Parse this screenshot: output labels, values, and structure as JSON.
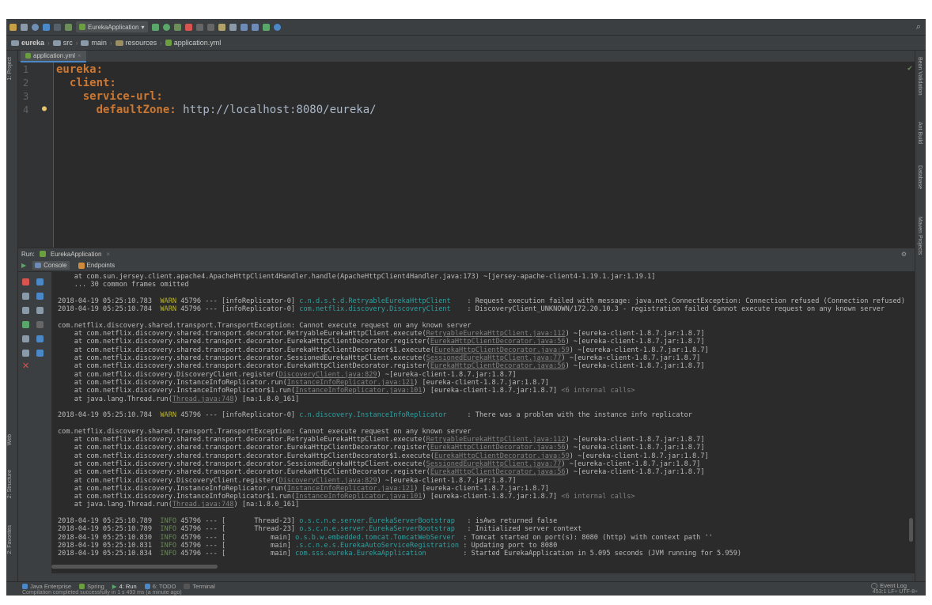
{
  "toolbar": {
    "run_config": "EurekaApplication"
  },
  "breadcrumb": [
    "eureka",
    "src",
    "main",
    "resources",
    "application.yml"
  ],
  "editor": {
    "tab": "application.yml",
    "lines": [
      {
        "n": "1",
        "key": "eureka:",
        "value": ""
      },
      {
        "n": "2",
        "key": "  client:",
        "value": ""
      },
      {
        "n": "3",
        "key": "    service-url:",
        "value": ""
      },
      {
        "n": "4",
        "key": "      defaultZone:",
        "value": " http://localhost:8080/eureka/"
      }
    ]
  },
  "left_strip": {
    "project": "1: Project",
    "web": "Web",
    "structure": "2: Structure",
    "favorites": "2: Favorites"
  },
  "right_strip": {
    "bean": "Bean Validation",
    "ant": "Ant Build",
    "database": "Database",
    "maven": "Maven Projects"
  },
  "run": {
    "label": "Run:",
    "config": "EurekaApplication",
    "console_tab": "Console",
    "endpoints_tab": "Endpoints"
  },
  "console": [
    {
      "t": "plain",
      "parts": [
        {
          "c": "",
          "s": "    at com.sun.jersey.client.apache4.ApacheHttpClient4Handler.handle(ApacheHttpClient4Handler.java:173) ~[jersey-apache-client4-1.19.1.jar:1.19.1]"
        }
      ]
    },
    {
      "t": "plain",
      "parts": [
        {
          "c": "",
          "s": "    ... 30 common frames omitted"
        }
      ]
    },
    {
      "t": "blank"
    },
    {
      "t": "log",
      "parts": [
        {
          "c": "",
          "s": "2018-04-19 05:25:10.783  "
        },
        {
          "c": "warn",
          "s": "WARN"
        },
        {
          "c": "",
          "s": " 45796 --- [infoReplicator-0] "
        },
        {
          "c": "cls",
          "s": "c.n.d.s.t.d.RetryableEurekaHttpClient"
        },
        {
          "c": "",
          "s": "    : Request execution failed with message: java.net.ConnectException: Connection refused (Connection refused)"
        }
      ]
    },
    {
      "t": "log",
      "parts": [
        {
          "c": "",
          "s": "2018-04-19 05:25:10.784  "
        },
        {
          "c": "warn",
          "s": "WARN"
        },
        {
          "c": "",
          "s": " 45796 --- [infoReplicator-0] "
        },
        {
          "c": "cls",
          "s": "com.netflix.discovery.DiscoveryClient"
        },
        {
          "c": "",
          "s": "    : DiscoveryClient_UNKNOWN/172.20.10.3 - registration failed Cannot execute request on any known server"
        }
      ]
    },
    {
      "t": "blank"
    },
    {
      "t": "plain",
      "parts": [
        {
          "c": "",
          "s": "com.netflix.discovery.shared.transport.TransportException: Cannot execute request on any known server"
        }
      ]
    },
    {
      "t": "plain",
      "parts": [
        {
          "c": "",
          "s": "    at com.netflix.discovery.shared.transport.decorator.RetryableEurekaHttpClient.execute("
        },
        {
          "c": "lnk",
          "s": "RetryableEurekaHttpClient.java:112"
        },
        {
          "c": "",
          "s": ") ~[eureka-client-1.8.7.jar:1.8.7]"
        }
      ]
    },
    {
      "t": "plain",
      "parts": [
        {
          "c": "",
          "s": "    at com.netflix.discovery.shared.transport.decorator.EurekaHttpClientDecorator.register("
        },
        {
          "c": "lnk",
          "s": "EurekaHttpClientDecorator.java:56"
        },
        {
          "c": "",
          "s": ") ~[eureka-client-1.8.7.jar:1.8.7]"
        }
      ]
    },
    {
      "t": "plain",
      "parts": [
        {
          "c": "",
          "s": "    at com.netflix.discovery.shared.transport.decorator.EurekaHttpClientDecorator$1.execute("
        },
        {
          "c": "lnk",
          "s": "EurekaHttpClientDecorator.java:59"
        },
        {
          "c": "",
          "s": ") ~[eureka-client-1.8.7.jar:1.8.7]"
        }
      ]
    },
    {
      "t": "plain",
      "parts": [
        {
          "c": "",
          "s": "    at com.netflix.discovery.shared.transport.decorator.SessionedEurekaHttpClient.execute("
        },
        {
          "c": "lnk",
          "s": "SessionedEurekaHttpClient.java:77"
        },
        {
          "c": "",
          "s": ") ~[eureka-client-1.8.7.jar:1.8.7]"
        }
      ]
    },
    {
      "t": "plain",
      "parts": [
        {
          "c": "",
          "s": "    at com.netflix.discovery.shared.transport.decorator.EurekaHttpClientDecorator.register("
        },
        {
          "c": "lnk",
          "s": "EurekaHttpClientDecorator.java:56"
        },
        {
          "c": "",
          "s": ") ~[eureka-client-1.8.7.jar:1.8.7]"
        }
      ]
    },
    {
      "t": "plain",
      "parts": [
        {
          "c": "",
          "s": "    at com.netflix.discovery.DiscoveryClient.register("
        },
        {
          "c": "lnk",
          "s": "DiscoveryClient.java:829"
        },
        {
          "c": "",
          "s": ") ~[eureka-client-1.8.7.jar:1.8.7]"
        }
      ]
    },
    {
      "t": "plain",
      "parts": [
        {
          "c": "",
          "s": "    at com.netflix.discovery.InstanceInfoReplicator.run("
        },
        {
          "c": "lnk",
          "s": "InstanceInfoReplicator.java:121"
        },
        {
          "c": "",
          "s": ") [eureka-client-1.8.7.jar:1.8.7]"
        }
      ]
    },
    {
      "t": "plain",
      "parts": [
        {
          "c": "",
          "s": "    at com.netflix.discovery.InstanceInfoReplicator$1.run("
        },
        {
          "c": "lnk",
          "s": "InstanceInfoReplicator.java:101"
        },
        {
          "c": "",
          "s": ") [eureka-client-1.8.7.jar:1.8.7] "
        },
        {
          "c": "dim",
          "s": "<6 internal calls>"
        }
      ]
    },
    {
      "t": "plain",
      "parts": [
        {
          "c": "",
          "s": "    at java.lang.Thread.run("
        },
        {
          "c": "lnk",
          "s": "Thread.java:748"
        },
        {
          "c": "",
          "s": ") [na:1.8.0_161]"
        }
      ]
    },
    {
      "t": "blank"
    },
    {
      "t": "log",
      "parts": [
        {
          "c": "",
          "s": "2018-04-19 05:25:10.784  "
        },
        {
          "c": "warn",
          "s": "WARN"
        },
        {
          "c": "",
          "s": " 45796 --- [infoReplicator-0] "
        },
        {
          "c": "cls",
          "s": "c.n.discovery.InstanceInfoReplicator"
        },
        {
          "c": "",
          "s": "     : There was a problem with the instance info replicator"
        }
      ]
    },
    {
      "t": "blank"
    },
    {
      "t": "plain",
      "parts": [
        {
          "c": "",
          "s": "com.netflix.discovery.shared.transport.TransportException: Cannot execute request on any known server"
        }
      ]
    },
    {
      "t": "plain",
      "parts": [
        {
          "c": "",
          "s": "    at com.netflix.discovery.shared.transport.decorator.RetryableEurekaHttpClient.execute("
        },
        {
          "c": "lnk",
          "s": "RetryableEurekaHttpClient.java:112"
        },
        {
          "c": "",
          "s": ") ~[eureka-client-1.8.7.jar:1.8.7]"
        }
      ]
    },
    {
      "t": "plain",
      "parts": [
        {
          "c": "",
          "s": "    at com.netflix.discovery.shared.transport.decorator.EurekaHttpClientDecorator.register("
        },
        {
          "c": "lnk",
          "s": "EurekaHttpClientDecorator.java:56"
        },
        {
          "c": "",
          "s": ") ~[eureka-client-1.8.7.jar:1.8.7]"
        }
      ]
    },
    {
      "t": "plain",
      "parts": [
        {
          "c": "",
          "s": "    at com.netflix.discovery.shared.transport.decorator.EurekaHttpClientDecorator$1.execute("
        },
        {
          "c": "lnk",
          "s": "EurekaHttpClientDecorator.java:59"
        },
        {
          "c": "",
          "s": ") ~[eureka-client-1.8.7.jar:1.8.7]"
        }
      ]
    },
    {
      "t": "plain",
      "parts": [
        {
          "c": "",
          "s": "    at com.netflix.discovery.shared.transport.decorator.SessionedEurekaHttpClient.execute("
        },
        {
          "c": "lnk",
          "s": "SessionedEurekaHttpClient.java:77"
        },
        {
          "c": "",
          "s": ") ~[eureka-client-1.8.7.jar:1.8.7]"
        }
      ]
    },
    {
      "t": "plain",
      "parts": [
        {
          "c": "",
          "s": "    at com.netflix.discovery.shared.transport.decorator.EurekaHttpClientDecorator.register("
        },
        {
          "c": "lnk",
          "s": "EurekaHttpClientDecorator.java:56"
        },
        {
          "c": "",
          "s": ") ~[eureka-client-1.8.7.jar:1.8.7]"
        }
      ]
    },
    {
      "t": "plain",
      "parts": [
        {
          "c": "",
          "s": "    at com.netflix.discovery.DiscoveryClient.register("
        },
        {
          "c": "lnk",
          "s": "DiscoveryClient.java:829"
        },
        {
          "c": "",
          "s": ") ~[eureka-client-1.8.7.jar:1.8.7]"
        }
      ]
    },
    {
      "t": "plain",
      "parts": [
        {
          "c": "",
          "s": "    at com.netflix.discovery.InstanceInfoReplicator.run("
        },
        {
          "c": "lnk",
          "s": "InstanceInfoReplicator.java:121"
        },
        {
          "c": "",
          "s": ") [eureka-client-1.8.7.jar:1.8.7]"
        }
      ]
    },
    {
      "t": "plain",
      "parts": [
        {
          "c": "",
          "s": "    at com.netflix.discovery.InstanceInfoReplicator$1.run("
        },
        {
          "c": "lnk",
          "s": "InstanceInfoReplicator.java:101"
        },
        {
          "c": "",
          "s": ") [eureka-client-1.8.7.jar:1.8.7] "
        },
        {
          "c": "dim",
          "s": "<6 internal calls>"
        }
      ]
    },
    {
      "t": "plain",
      "parts": [
        {
          "c": "",
          "s": "    at java.lang.Thread.run("
        },
        {
          "c": "lnk",
          "s": "Thread.java:748"
        },
        {
          "c": "",
          "s": ") [na:1.8.0_161]"
        }
      ]
    },
    {
      "t": "blank"
    },
    {
      "t": "log",
      "parts": [
        {
          "c": "",
          "s": "2018-04-19 05:25:10.789  "
        },
        {
          "c": "info",
          "s": "INFO"
        },
        {
          "c": "",
          "s": " 45796 --- [       Thread-23] "
        },
        {
          "c": "cls",
          "s": "o.s.c.n.e.server.EurekaServerBootstrap"
        },
        {
          "c": "",
          "s": "   : isAws returned false"
        }
      ]
    },
    {
      "t": "log",
      "parts": [
        {
          "c": "",
          "s": "2018-04-19 05:25:10.789  "
        },
        {
          "c": "info",
          "s": "INFO"
        },
        {
          "c": "",
          "s": " 45796 --- [       Thread-23] "
        },
        {
          "c": "cls",
          "s": "o.s.c.n.e.server.EurekaServerBootstrap"
        },
        {
          "c": "",
          "s": "   : Initialized server context"
        }
      ]
    },
    {
      "t": "log",
      "parts": [
        {
          "c": "",
          "s": "2018-04-19 05:25:10.830  "
        },
        {
          "c": "info",
          "s": "INFO"
        },
        {
          "c": "",
          "s": " 45796 --- [           main] "
        },
        {
          "c": "cls",
          "s": "o.s.b.w.embedded.tomcat.TomcatWebServer"
        },
        {
          "c": "",
          "s": "  : Tomcat started on port(s): 8080 (http) with context path ''"
        }
      ]
    },
    {
      "t": "log",
      "parts": [
        {
          "c": "",
          "s": "2018-04-19 05:25:10.831  "
        },
        {
          "c": "info",
          "s": "INFO"
        },
        {
          "c": "",
          "s": " 45796 --- [           main] "
        },
        {
          "c": "cls",
          "s": ".s.c.n.e.s.EurekaAutoServiceRegistration"
        },
        {
          "c": "",
          "s": " : Updating port to 8080"
        }
      ]
    },
    {
      "t": "log",
      "parts": [
        {
          "c": "",
          "s": "2018-04-19 05:25:10.834  "
        },
        {
          "c": "info",
          "s": "INFO"
        },
        {
          "c": "",
          "s": " 45796 --- [           main] "
        },
        {
          "c": "cls",
          "s": "com.sss.eureka.EurekaApplication"
        },
        {
          "c": "",
          "s": "         : Started EurekaApplication in 5.095 seconds (JVM running for 5.959)"
        }
      ]
    }
  ],
  "bottom_tabs": [
    "Java Enterprise",
    "Spring",
    "4: Run",
    "6: TODO",
    "Terminal"
  ],
  "event_log": "Event Log",
  "status": {
    "message": "Compilation completed successfully in 1 s 493 ms (a minute ago)",
    "position": "453:1  LF÷  UTF-8÷"
  }
}
